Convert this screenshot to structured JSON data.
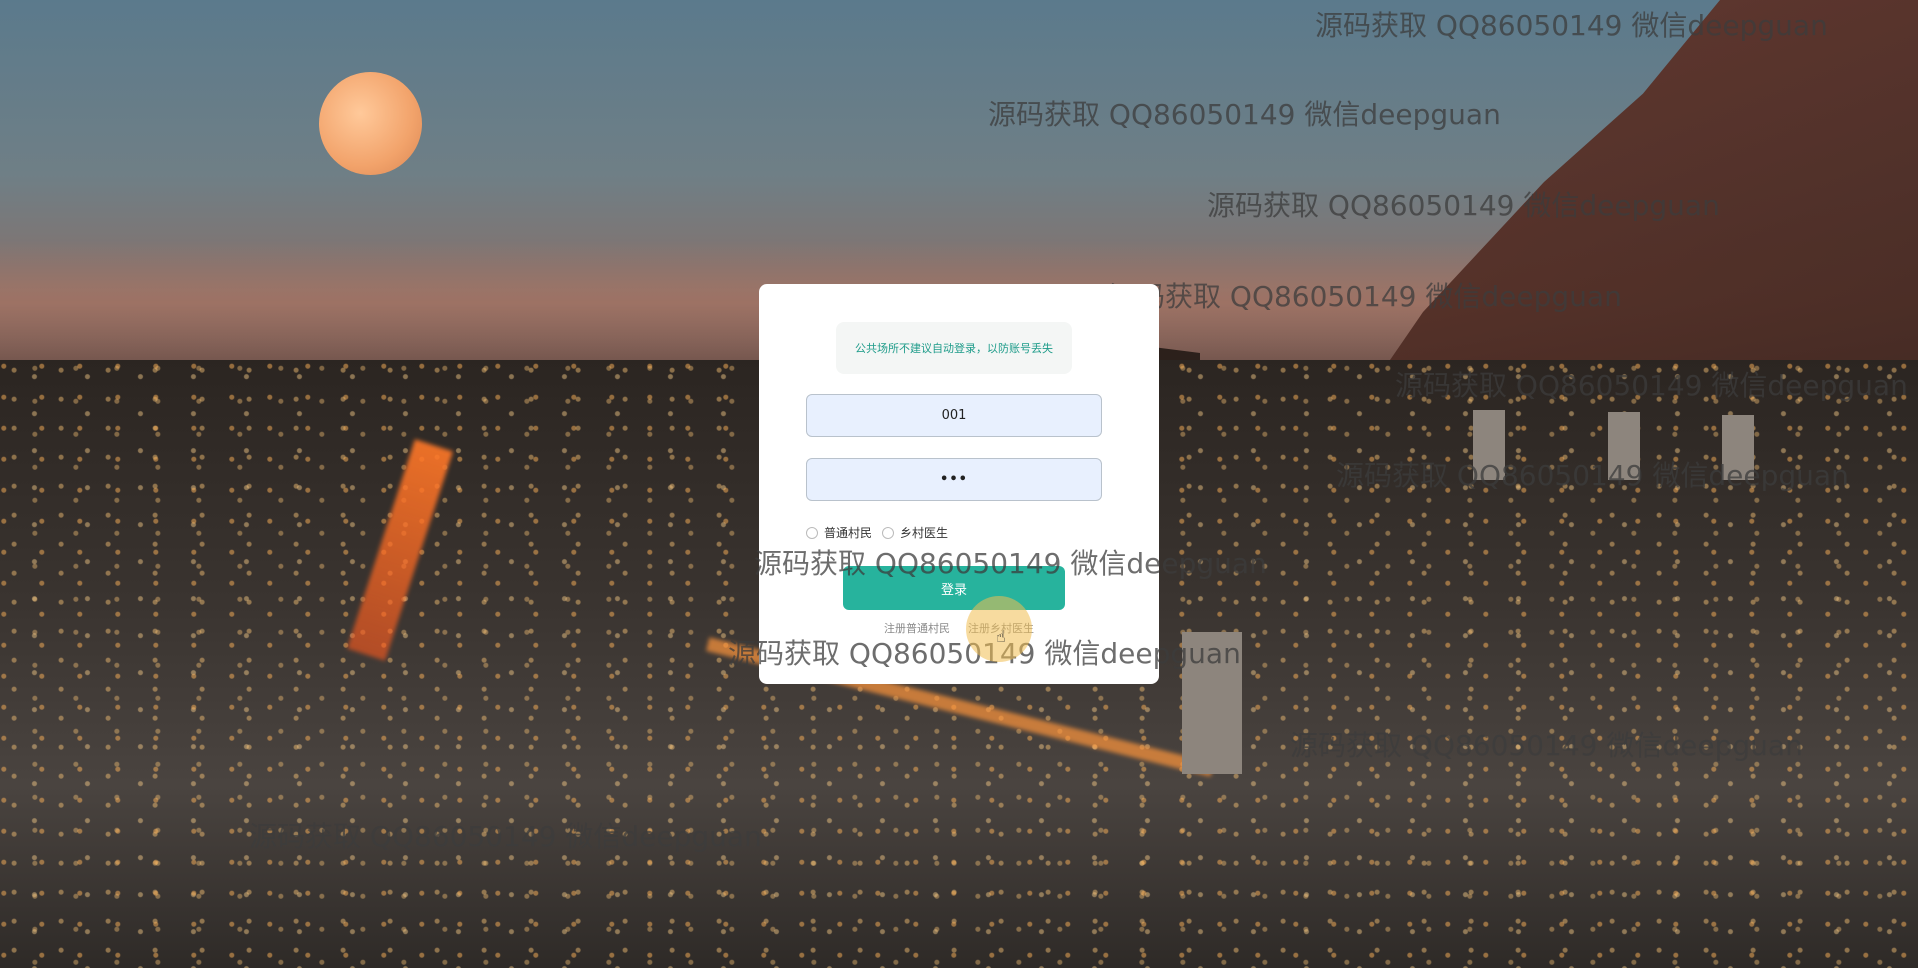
{
  "login": {
    "notice": "公共场所不建议自动登录，以防账号丢失",
    "username_value": "001",
    "password_value": "•••",
    "roles": [
      {
        "label": "普通村民"
      },
      {
        "label": "乡村医生"
      }
    ],
    "login_button": "登录",
    "register_links": [
      {
        "label": "注册普通村民"
      },
      {
        "label": "注册乡村医生"
      }
    ]
  },
  "watermark_text": "源码获取 QQ86050149 微信deepguan",
  "colors": {
    "accent": "#27b39d",
    "notice_text": "#1f9c8a",
    "input_bg": "#e8f0fe"
  },
  "icons": {
    "cursor": "hand-pointer-icon"
  }
}
